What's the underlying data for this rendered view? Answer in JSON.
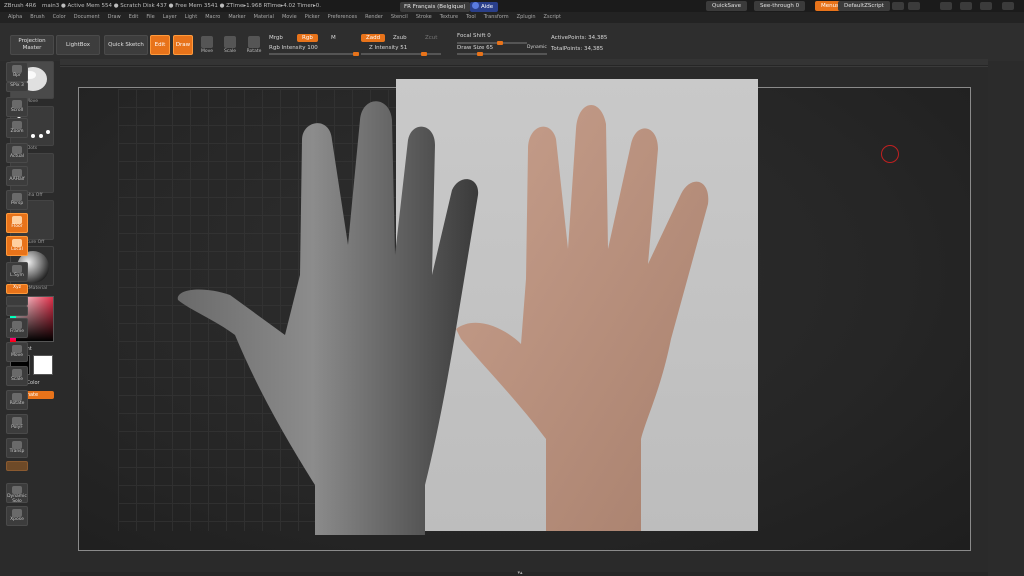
{
  "titlebar": {
    "app": "ZBrush 4R6",
    "info": "main3  ●  Active Mem 554  ●  Scratch Disk 437  ●  Free Mem 3541  ●  ZTime▸1.968  RTime▸4.02  Timer▸0.",
    "language": "FR Français (Belgique)",
    "help": "Aide",
    "quicksave": "QuickSave",
    "see_through": "See-through  0",
    "menus": "Menus",
    "default_script": "DefaultZScript"
  },
  "menubar": {
    "items": [
      "Alpha",
      "Brush",
      "Color",
      "Document",
      "Draw",
      "Edit",
      "File",
      "Layer",
      "Light",
      "Macro",
      "Marker",
      "Material",
      "Movie",
      "Picker",
      "Preferences",
      "Render",
      "Stencil",
      "Stroke",
      "Texture",
      "Tool",
      "Transform",
      "Zplugin",
      "Zscript"
    ]
  },
  "toolbar": {
    "projection_master": "Projection Master",
    "lightbox": "LightBox",
    "quick_sketch": "Quick Sketch",
    "edit": "Edit",
    "draw": "Draw",
    "move": "Move",
    "scale": "Scale",
    "rotate": "Rotate",
    "mrgb": "Mrgb",
    "rgb": "Rgb",
    "m": "M",
    "rgb_intensity": "Rgb Intensity 100",
    "zadd": "Zadd",
    "zsub": "Zsub",
    "zcut": "Zcut",
    "z_intensity": "Z Intensity 51",
    "focal_shift": "Focal Shift 0",
    "draw_size": "Draw Size 65",
    "dynamic": "Dynamic",
    "active_points": "ActivePoints: 34,385",
    "total_points": "TotalPoints: 34,385"
  },
  "leftshelf": {
    "brush_label": "Move",
    "stroke_label": "Dots",
    "alpha_label": "Alpha Off",
    "texture_label": "Texture Off",
    "material_label": "BasicMaterial",
    "gradient": "Gradient",
    "switchcolor": "SwitchColor",
    "alternate": "Alternate"
  },
  "rightshelf": {
    "items": [
      "Bpr",
      "SPix 3",
      "Scroll",
      "Zoom",
      "Actual",
      "AAHalf",
      "Persp",
      "Floor",
      "Local",
      "L.Sym",
      "Xyz",
      "",
      "",
      "Frame",
      "Move",
      "Scale",
      "Rotate",
      "PolyF",
      "Transp",
      "",
      "Dynamic Solo",
      "Xpose"
    ]
  },
  "colors": {
    "accent": "#e8731a",
    "cursor": "#c02020"
  }
}
